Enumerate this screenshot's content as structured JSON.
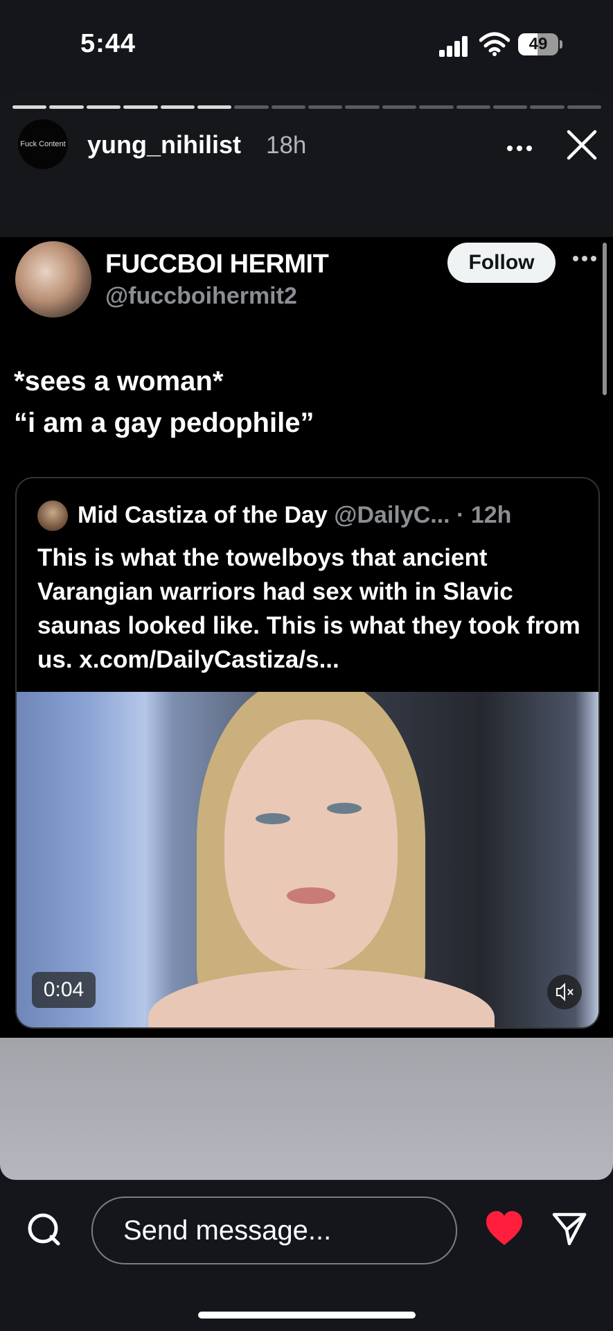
{
  "status_bar": {
    "time": "5:44",
    "battery": "49"
  },
  "story": {
    "avatar_text": "Fuck Content",
    "username": "yung_nihilist",
    "time": "18h",
    "segments_total": 16,
    "segments_done": 6
  },
  "tweet": {
    "name": "FUCCBOI HERMIT",
    "handle": "@fuccboihermit2",
    "follow_label": "Follow",
    "text": "*sees a woman*\n“i am a gay pedophile”"
  },
  "quote": {
    "name": "Mid Castiza of the Day",
    "meta": "@DailyC... · 12h",
    "text": "This is what the towelboys that ancient Varangian warriors had sex with in Slavic saunas looked like. This is what they took from us. x.com/DailyCastiza/s...",
    "video_time": "0:04"
  },
  "bottom_bar": {
    "message_placeholder": "Send message..."
  },
  "colors": {
    "heart": "#ff1f3d",
    "background": "#14161b"
  }
}
